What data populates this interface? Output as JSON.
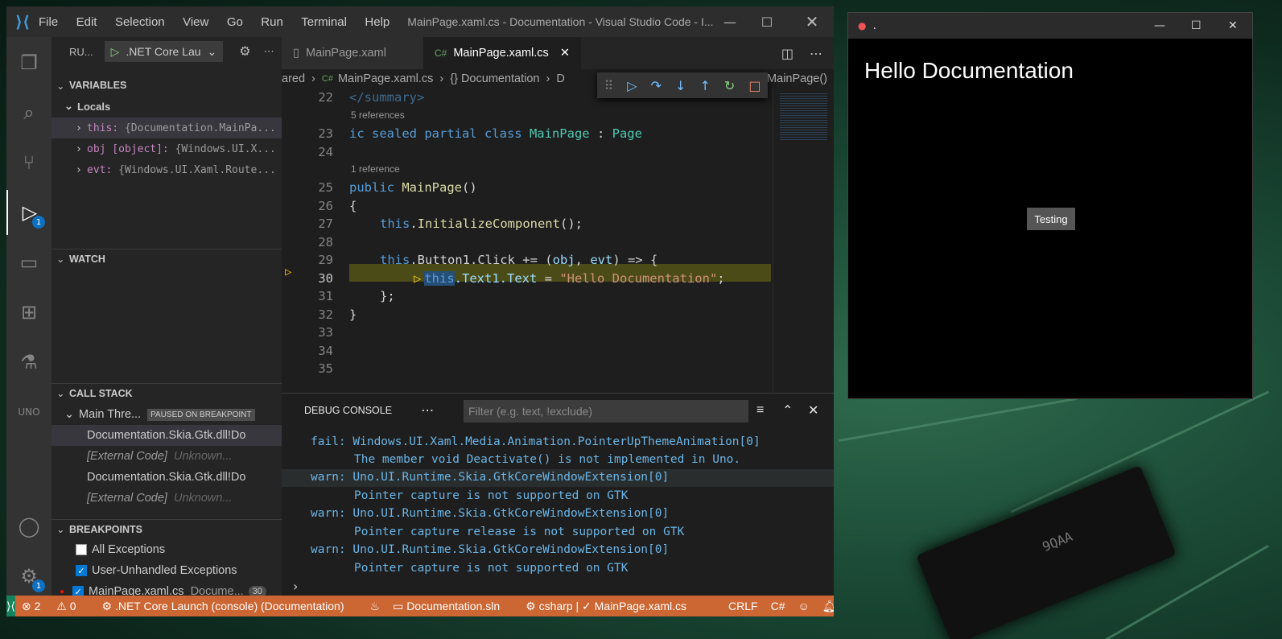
{
  "vscode": {
    "title": "MainPage.xaml.cs - Documentation - Visual Studio Code - I...",
    "menu": [
      "File",
      "Edit",
      "Selection",
      "View",
      "Go",
      "Run",
      "Terminal",
      "Help"
    ],
    "activity_badges": {
      "debug": "1",
      "settings": "1"
    },
    "sidebar": {
      "run_label": "RU...",
      "config": ".NET Core Lau",
      "variables_header": "VARIABLES",
      "locals_label": "Locals",
      "locals": [
        {
          "name": "this:",
          "value": "{Documentation.MainPa..."
        },
        {
          "name": "obj [object]:",
          "value": "{Windows.UI.X..."
        },
        {
          "name": "evt:",
          "value": "{Windows.UI.Xaml.Route..."
        }
      ],
      "watch_header": "WATCH",
      "callstack_header": "CALL STACK",
      "thread_label": "Main Thre...",
      "thread_status": "PAUSED ON BREAKPOINT",
      "frames": [
        {
          "name": "Documentation.Skia.Gtk.dll!Do",
          "source": ""
        },
        {
          "name": "[External Code]",
          "source": "Unknown..."
        },
        {
          "name": "Documentation.Skia.Gtk.dll!Do",
          "source": ""
        },
        {
          "name": "[External Code]",
          "source": "Unknown..."
        }
      ],
      "breakpoints_header": "BREAKPOINTS",
      "breakpoints": [
        {
          "label": "All Exceptions",
          "checked": false
        },
        {
          "label": "User-Unhandled Exceptions",
          "checked": true
        },
        {
          "label": "MainPage.xaml.cs",
          "detail": "Docume...",
          "line": "30",
          "checked": true
        }
      ]
    },
    "tabs": [
      {
        "label": "MainPage.xaml",
        "active": false
      },
      {
        "label": "MainPage.xaml.cs",
        "active": true
      }
    ],
    "breadcrumbs": {
      "part1": "ared",
      "part2": "MainPage.xaml.cs",
      "part3": "{} Documentation",
      "part4": "D",
      "part5": "MainPage()"
    },
    "code": {
      "lines": [
        "22",
        "23",
        "24",
        "25",
        "26",
        "27",
        "28",
        "29",
        "30",
        "31",
        "32",
        "33",
        "34",
        "35"
      ],
      "lens1": "5 references",
      "lens2": "1 reference",
      "l22": "</summary>",
      "l23a": "ic sealed partial class ",
      "l23b": "MainPage",
      "l23c": " : ",
      "l23d": "Page",
      "l25a": "public ",
      "l25b": "MainPage",
      "l25c": "()",
      "l26": "{",
      "l27a": "this",
      "l27b": ".",
      "l27c": "InitializeComponent",
      "l27d": "();",
      "l29a": "this",
      "l29b": ".Button1.Click += (",
      "l29c": "obj",
      "l29d": ", ",
      "l29e": "evt",
      "l29f": ") => {",
      "l30a": "this",
      "l30b": ".Text1.Text",
      "l30c": " = ",
      "l30d": "\"Hello Documentation\"",
      "l30e": ";",
      "l31": "};",
      "l32": "}"
    },
    "panel": {
      "title": "DEBUG CONSOLE",
      "filter_placeholder": "Filter (e.g. text, !exclude)",
      "lines": [
        {
          "level": "fail:",
          "text": "Windows.UI.Xaml.Media.Animation.PointerUpThemeAnimation[0]"
        },
        {
          "level": "",
          "text": "The member void Deactivate() is not implemented in Uno."
        },
        {
          "level": "warn:",
          "text": "Uno.UI.Runtime.Skia.GtkCoreWindowExtension[0]"
        },
        {
          "level": "",
          "text": "Pointer capture is not supported on GTK"
        },
        {
          "level": "warn:",
          "text": "Uno.UI.Runtime.Skia.GtkCoreWindowExtension[0]"
        },
        {
          "level": "",
          "text": "Pointer capture release is not supported on GTK"
        },
        {
          "level": "warn:",
          "text": "Uno.UI.Runtime.Skia.GtkCoreWindowExtension[0]"
        },
        {
          "level": "",
          "text": "Pointer capture is not supported on GTK"
        }
      ]
    },
    "status": {
      "errors": "2",
      "warnings": "0",
      "launch": ".NET Core Launch (console) (Documentation)",
      "solution": "Documentation.sln",
      "omnisharp": "csharp | ✓ MainPage.xaml.cs",
      "eol": "CRLF",
      "lang": "C#"
    },
    "colors": {
      "statusbar": "#cc6633",
      "accent": "#0e70c0"
    }
  },
  "app": {
    "title": ".",
    "heading": "Hello Documentation",
    "button": "Testing"
  },
  "background": {
    "chip_text": "9QAA"
  }
}
